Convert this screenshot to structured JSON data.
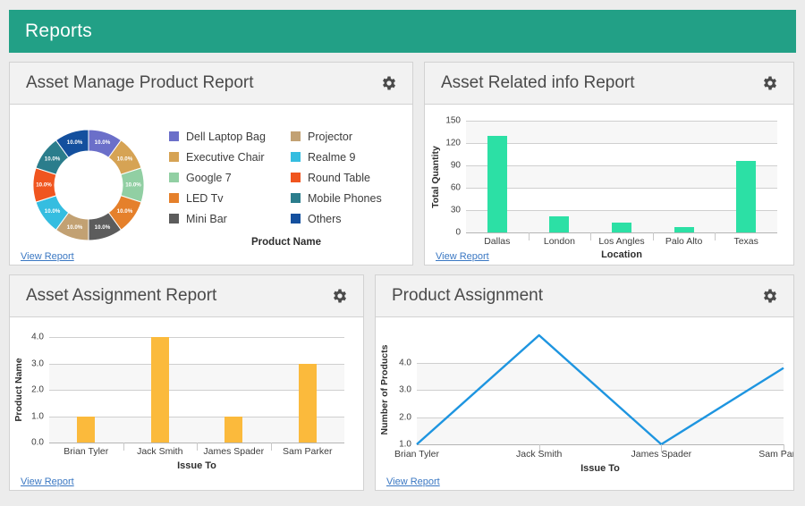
{
  "header": {
    "title": "Reports"
  },
  "common": {
    "view_report": "View Report",
    "gear_icon": "gear-icon"
  },
  "cards": [
    {
      "title": "Asset Manage Product Report",
      "legend_title": "Product Name",
      "slice_label": "10.0%"
    },
    {
      "title": "Asset Related info Report"
    },
    {
      "title": "Asset Assignment Report"
    },
    {
      "title": "Product Assignment"
    }
  ],
  "chart_data": [
    {
      "type": "pie",
      "title": "Asset Manage Product Report",
      "legend_title": "Product Name",
      "legend_position": "right",
      "labels": [
        "Dell Laptop Bag",
        "Executive Chair",
        "Google 7",
        "LED Tv",
        "Mini Bar",
        "Projector",
        "Realme 9",
        "Round Table",
        "Mobile Phones",
        "Others"
      ],
      "values": [
        10.0,
        10.0,
        10.0,
        10.0,
        10.0,
        10.0,
        10.0,
        10.0,
        10.0,
        10.0
      ],
      "value_labels": [
        "10.0%",
        "10.0%",
        "10.0%",
        "10.0%",
        "10.0%",
        "10.0%",
        "10.0%",
        "10.0%",
        "10.0%",
        "10.0%"
      ],
      "colors": [
        "#6b6fc9",
        "#d6a354",
        "#91cfa3",
        "#e5802b",
        "#5c5c5c",
        "#c2a173",
        "#35bde0",
        "#f0551f",
        "#2b7d8c",
        "#14509e"
      ],
      "donut": true
    },
    {
      "type": "bar",
      "title": "Asset Related info Report",
      "categories": [
        "Dallas",
        "London",
        "Los Angles",
        "Palo Alto",
        "Texas"
      ],
      "values": [
        130,
        22,
        13,
        7,
        96
      ],
      "xlabel": "Location",
      "ylabel": "Total Quantity",
      "yticks": [
        0,
        30,
        60,
        90,
        120,
        150
      ],
      "ylim": [
        0,
        150
      ],
      "bar_color": "#2ce0a5",
      "grid": true
    },
    {
      "type": "bar",
      "title": "Asset Assignment Report",
      "categories": [
        "Brian Tyler",
        "Jack Smith",
        "James Spader",
        "Sam Parker"
      ],
      "values": [
        1.0,
        4.0,
        1.0,
        3.0
      ],
      "xlabel": "Issue To",
      "ylabel": "Product Name",
      "yticks": [
        "0.0",
        "1.0",
        "2.0",
        "3.0",
        "4.0"
      ],
      "ylim": [
        0,
        4
      ],
      "bar_color": "#fbba3c",
      "grid": true
    },
    {
      "type": "line",
      "title": "Product Assignment",
      "x": [
        "Brian Tyler",
        "Jack Smith",
        "James Spader",
        "Sam Parker"
      ],
      "values": [
        1.0,
        5.0,
        1.0,
        3.8
      ],
      "xlabel": "Issue To",
      "ylabel": "Number of Products",
      "yticks": [
        "1.0",
        "2.0",
        "3.0",
        "4.0"
      ],
      "ylim": [
        1,
        5
      ],
      "line_color": "#1e95e0",
      "grid": true
    }
  ]
}
